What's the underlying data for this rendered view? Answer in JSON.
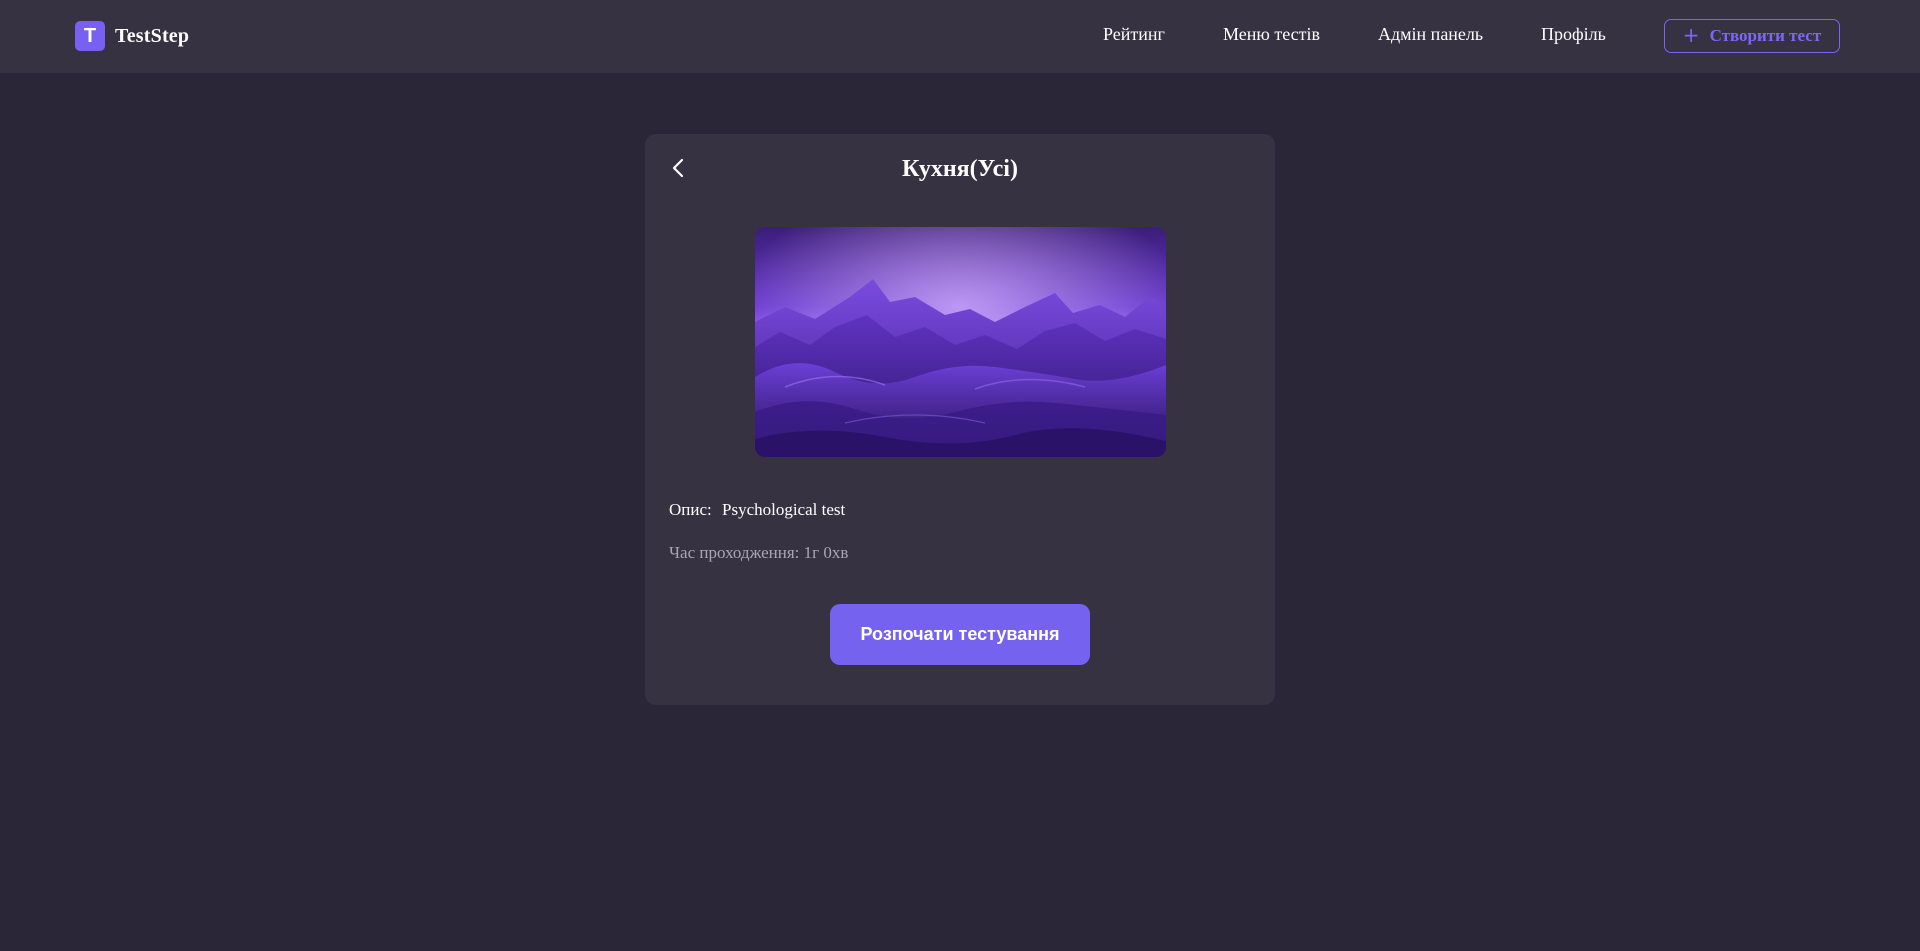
{
  "app": {
    "logo_letter": "T",
    "name": "TestStep"
  },
  "nav": {
    "rating": "Рейтинг",
    "tests_menu": "Меню тестів",
    "admin_panel": "Адмін панель",
    "profile": "Профіль",
    "create_test": "Створити тест"
  },
  "test": {
    "title": "Кухня(Усі)",
    "description_label": "Опис:",
    "description": "Psychological test",
    "duration_label": "Час проходження:",
    "duration": "1г 0хв",
    "start_button": "Розпочати тестування",
    "cover_icon": "purple-mountains-image"
  },
  "icons": {
    "back": "chevron-left-icon",
    "plus": "plus-icon"
  },
  "colors": {
    "background": "#2a2637",
    "surface": "#363241",
    "accent": "#7562ee",
    "muted_text": "#a9a5b2"
  }
}
